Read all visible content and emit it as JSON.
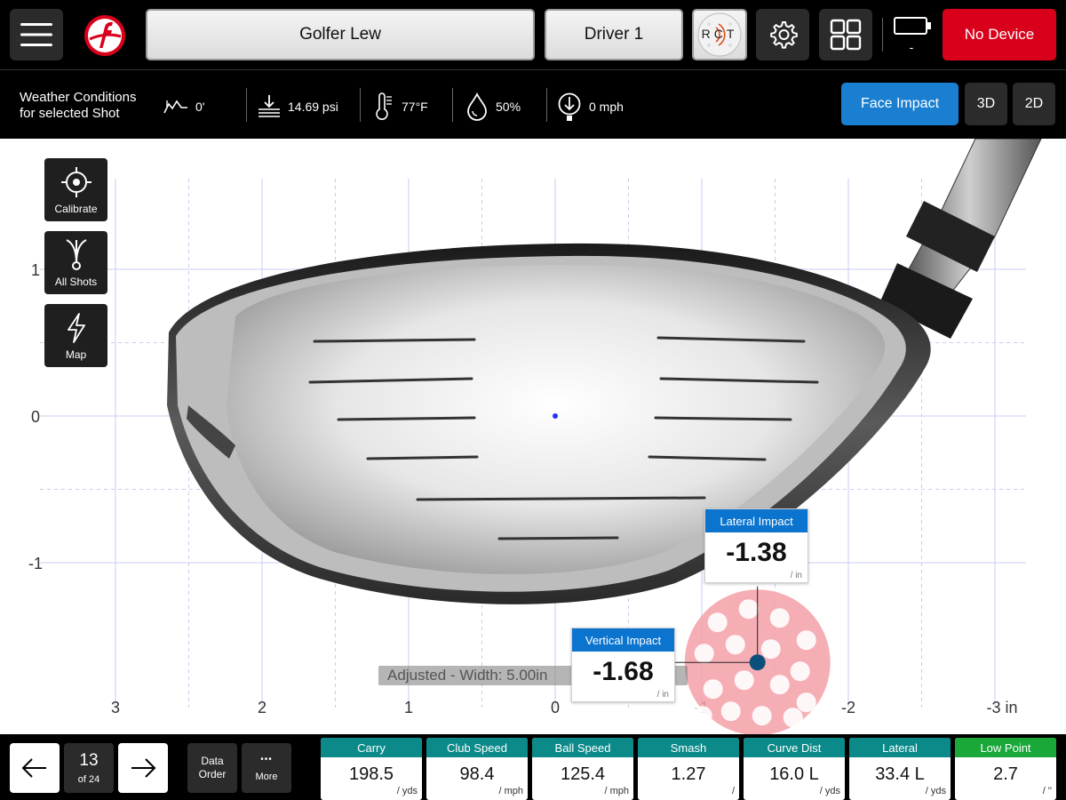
{
  "header": {
    "golfer_name": "Golfer Lew",
    "club_name": "Driver 1",
    "rct_label": "RCT",
    "battery_text": "-",
    "device_status": "No Device",
    "device_color": "#d9001b"
  },
  "weather": {
    "title_line1": "Weather Conditions",
    "title_line2": "for selected Shot",
    "altitude": "0'",
    "pressure": "14.69 psi",
    "temperature": "77°F",
    "humidity": "50%",
    "wind": "0 mph"
  },
  "views": {
    "face_impact": "Face Impact",
    "three_d": "3D",
    "two_d": "2D",
    "active_color": "#1a7fd1"
  },
  "sidebar": {
    "calibrate": "Calibrate",
    "all_shots": "All Shots",
    "map": "Map"
  },
  "chart_data": {
    "type": "scatter",
    "x_tick_labels": [
      "3",
      "2",
      "1",
      "0",
      "-1",
      "-2",
      "-3 in"
    ],
    "y_tick_labels": [
      "1",
      "0",
      "-1"
    ],
    "xlim": [
      3,
      -3
    ],
    "ylim": [
      -2,
      1.5
    ],
    "point": {
      "x": -1.38,
      "y": -1.68
    }
  },
  "impact": {
    "lateral_label": "Lateral Impact",
    "lateral_value": "-1.38",
    "lateral_unit": "/ in",
    "vertical_label": "Vertical Impact",
    "vertical_value": "-1.68",
    "vertical_unit": "/ in",
    "adjusted_text": "Adjusted - Width: 5.00in",
    "accent": "#0b74cf"
  },
  "navigation": {
    "shot_number": "13",
    "shot_total": "of 24",
    "data_order_line1": "Data",
    "data_order_line2": "Order",
    "more_label": "More",
    "more_glyph": "•••"
  },
  "metrics": [
    {
      "label": "Carry",
      "value": "198.5",
      "unit": "/ yds",
      "color": "#0c8a8a"
    },
    {
      "label": "Club Speed",
      "value": "98.4",
      "unit": "/ mph",
      "color": "#0c8a8a"
    },
    {
      "label": "Ball Speed",
      "value": "125.4",
      "unit": "/ mph",
      "color": "#0c8a8a"
    },
    {
      "label": "Smash",
      "value": "1.27",
      "unit": "/",
      "color": "#0c8a8a"
    },
    {
      "label": "Curve Dist",
      "value": "16.0 L",
      "unit": "/ yds",
      "color": "#0c8a8a"
    },
    {
      "label": "Lateral",
      "value": "33.4 L",
      "unit": "/ yds",
      "color": "#0c8a8a"
    },
    {
      "label": "Low Point",
      "value": "2.7",
      "unit": "/ ''",
      "color": "#1aa83a"
    }
  ]
}
